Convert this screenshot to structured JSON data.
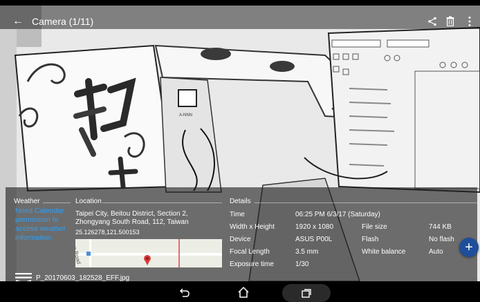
{
  "header": {
    "title": "Camera (1/11)",
    "icons": [
      "back-arrow-icon",
      "share-icon",
      "trash-icon",
      "more-vertical-icon"
    ]
  },
  "photo": {
    "description_icon": "sketch-photo"
  },
  "info": {
    "weather": {
      "heading": "Weather",
      "message": "Need Calendar permission to access weather information"
    },
    "location": {
      "heading": "Location",
      "address": "Taipei City, Beitou District, Section 2, Zhongyang South Road, 112, Taiwan",
      "coords": "25.126278,121.500153",
      "map_road_label": "ve Road"
    },
    "details": {
      "heading": "Details",
      "time_label": "Time",
      "time_value": "06:25 PM 6/3/17 (Saturday)",
      "wh_label": "Width x Height",
      "wh_value": "1920 x 1080",
      "filesize_label": "File size",
      "filesize_value": "744 KB",
      "device_label": "Device",
      "device_value": "ASUS P00L",
      "flash_label": "Flash",
      "flash_value": "No flash",
      "focal_label": "Focal Length",
      "focal_value": "3.5 mm",
      "wb_label": "White balance",
      "wb_value": "Auto",
      "exposure_label": "Exposure time",
      "exposure_value": "1/30"
    }
  },
  "filename": "P_20170603_182528_EFF.jpg",
  "colors": {
    "accent_blue": "#2fa0f4",
    "fab": "#1e4f9a",
    "panel": "rgba(30,30,30,0.62)"
  }
}
